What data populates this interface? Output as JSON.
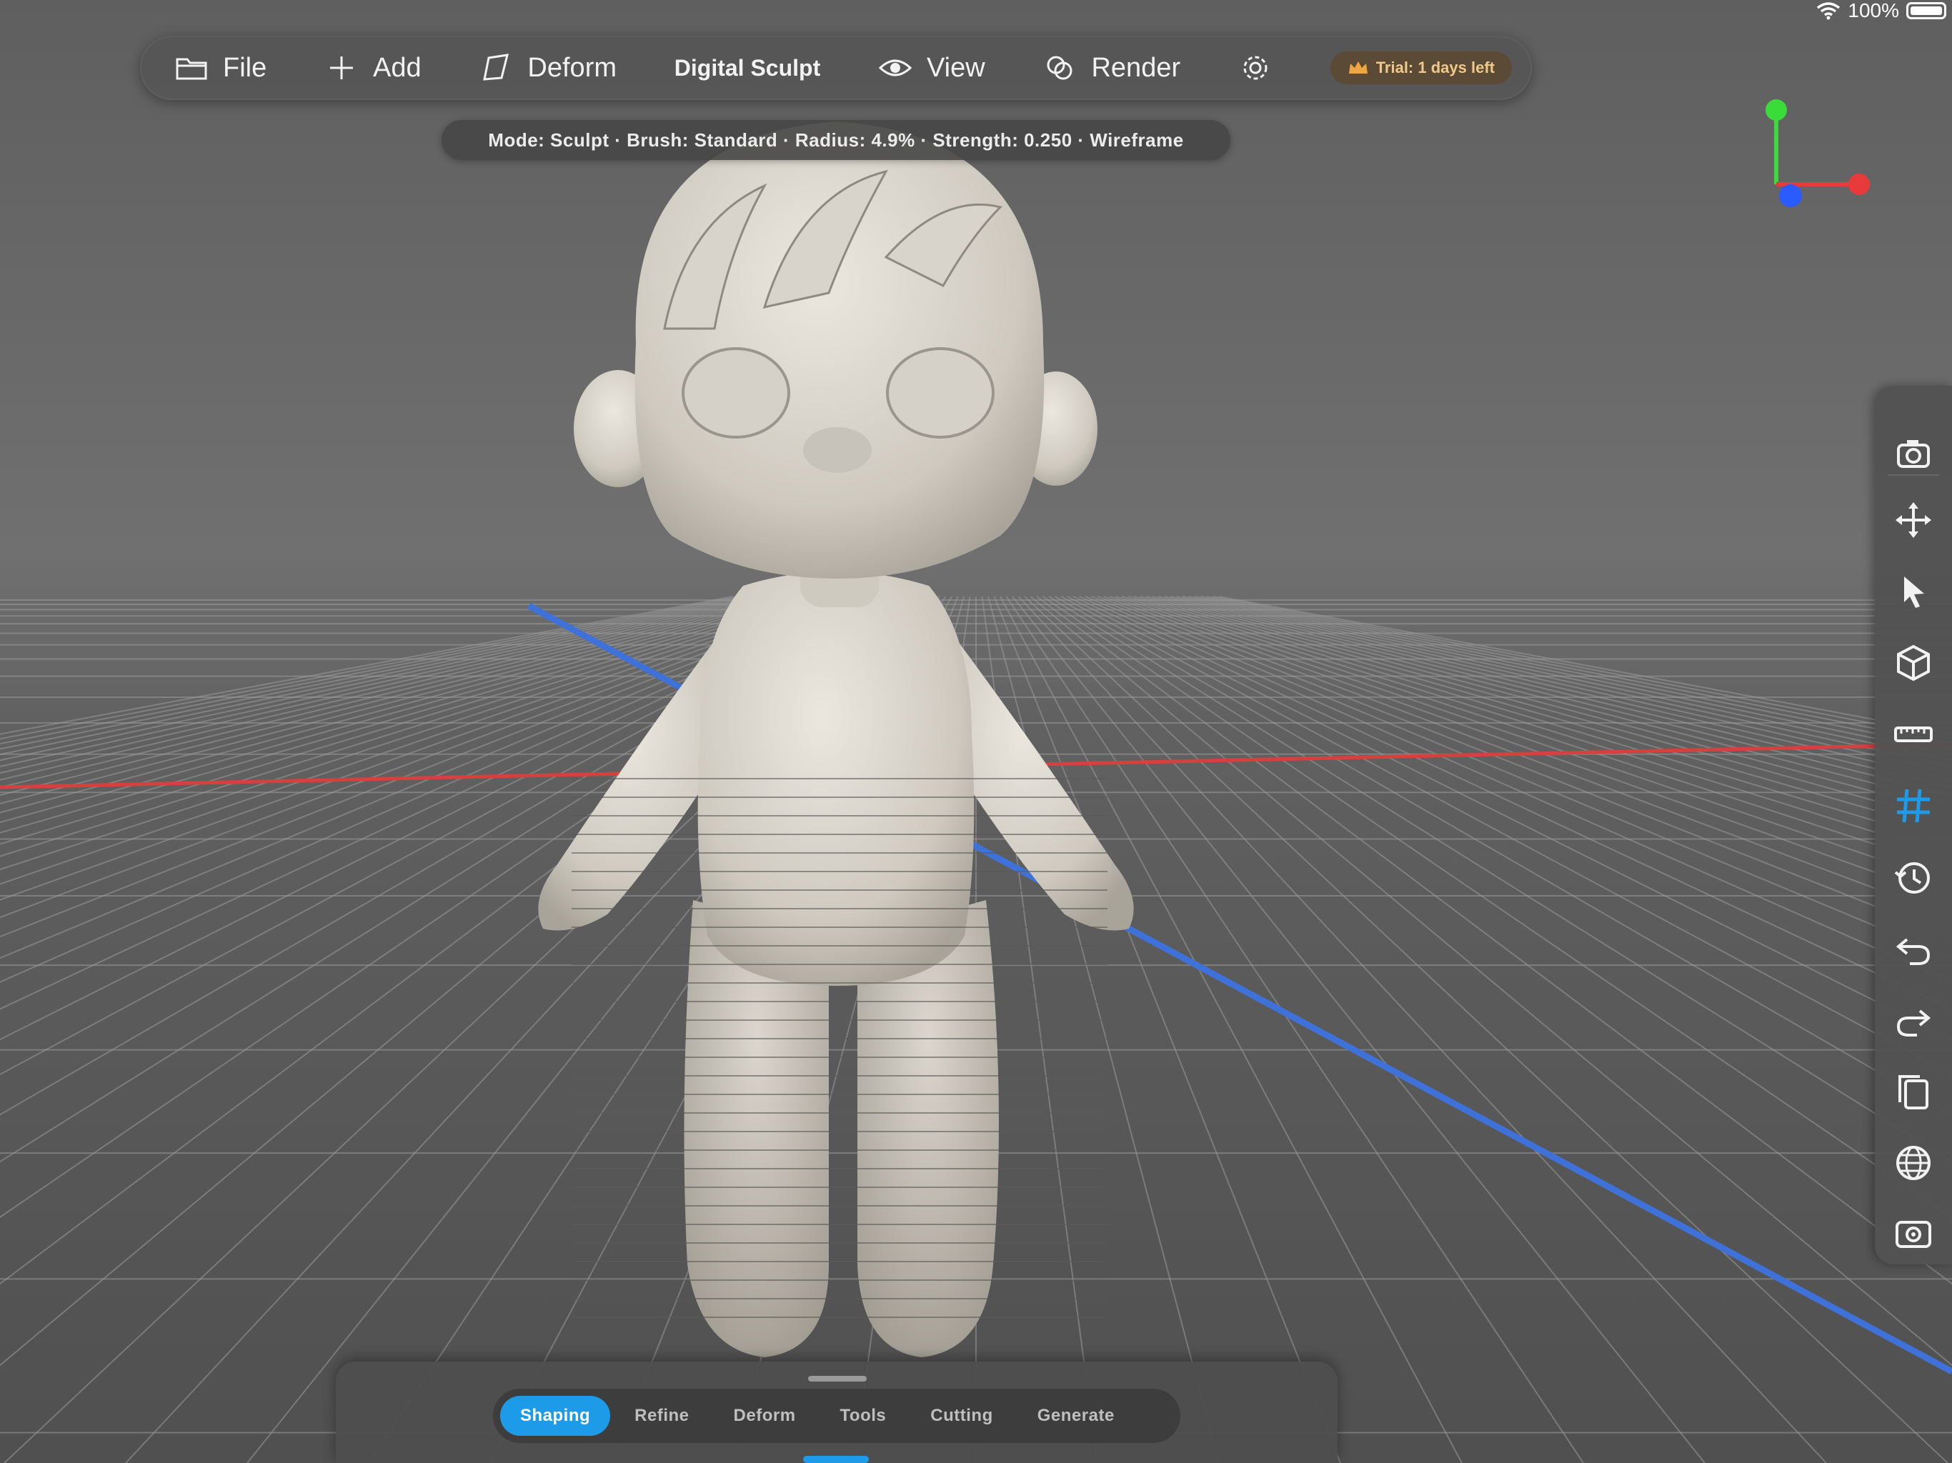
{
  "status_bar": {
    "battery_text": "100%"
  },
  "toolbar": {
    "file_label": "File",
    "add_label": "Add",
    "deform_label": "Deform",
    "title": "Digital Sculpt",
    "view_label": "View",
    "render_label": "Render",
    "trial_badge": "Trial: 1 days left"
  },
  "mode_status": "Mode: Sculpt · Brush: Standard · Radius: 4.9% · Strength: 0.250 · Wireframe",
  "right_rail": {
    "items": [
      {
        "icon": "camera-icon"
      },
      {
        "icon": "move-icon"
      },
      {
        "icon": "pointer-icon"
      },
      {
        "icon": "cube-icon"
      },
      {
        "icon": "ruler-icon"
      },
      {
        "icon": "grid-icon",
        "active": true
      },
      {
        "icon": "history-icon"
      },
      {
        "icon": "undo-icon"
      },
      {
        "icon": "redo-icon"
      },
      {
        "icon": "copy-icon"
      },
      {
        "icon": "globe-icon"
      },
      {
        "icon": "screenshot-icon"
      }
    ]
  },
  "bottom_tabs": {
    "active": "Shaping",
    "items": [
      "Shaping",
      "Refine",
      "Deform",
      "Tools",
      "Cutting",
      "Generate"
    ]
  },
  "colors": {
    "accent": "#1e9be8",
    "axis_x": "#e83a3a",
    "axis_y": "#3adc3a",
    "axis_z": "#2a5bff",
    "trial_badge_text": "#f0c98a"
  }
}
